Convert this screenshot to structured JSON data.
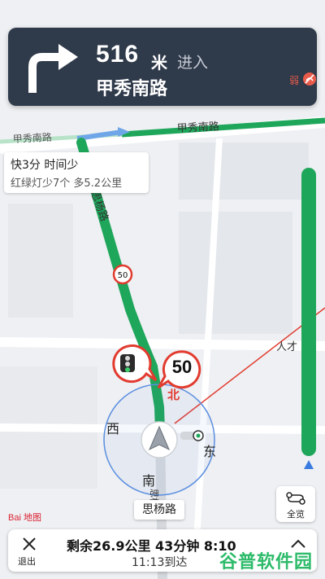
{
  "nav": {
    "distance": "516",
    "unit": "米",
    "action": "进入",
    "road": "甲秀南路",
    "signal": "弱"
  },
  "map": {
    "road_labels": [
      "甲秀南路",
      "甲秀南路",
      "思杨路",
      "人才"
    ],
    "speed_limit": "50",
    "speed_now": "50",
    "compass": {
      "n": "北",
      "w": "西",
      "e": "东",
      "s": "南"
    },
    "current_road": "思杨路",
    "south_road": "思杨"
  },
  "route_card": {
    "line1": "快3分 时间少",
    "line2": "红绿灯少7个 多5.2公里"
  },
  "overview": {
    "label": "全览"
  },
  "brand": {
    "logo_text": "Bai 地图"
  },
  "bottom": {
    "exit_label": "退出",
    "remaining": "剩余26.9公里 43分钟 8:10",
    "eta": "11:13到达"
  },
  "watermark": "谷普软件园",
  "colors": {
    "route": "#1ea65a",
    "panel": "#2f3a4a",
    "alert": "#e23b2f"
  }
}
